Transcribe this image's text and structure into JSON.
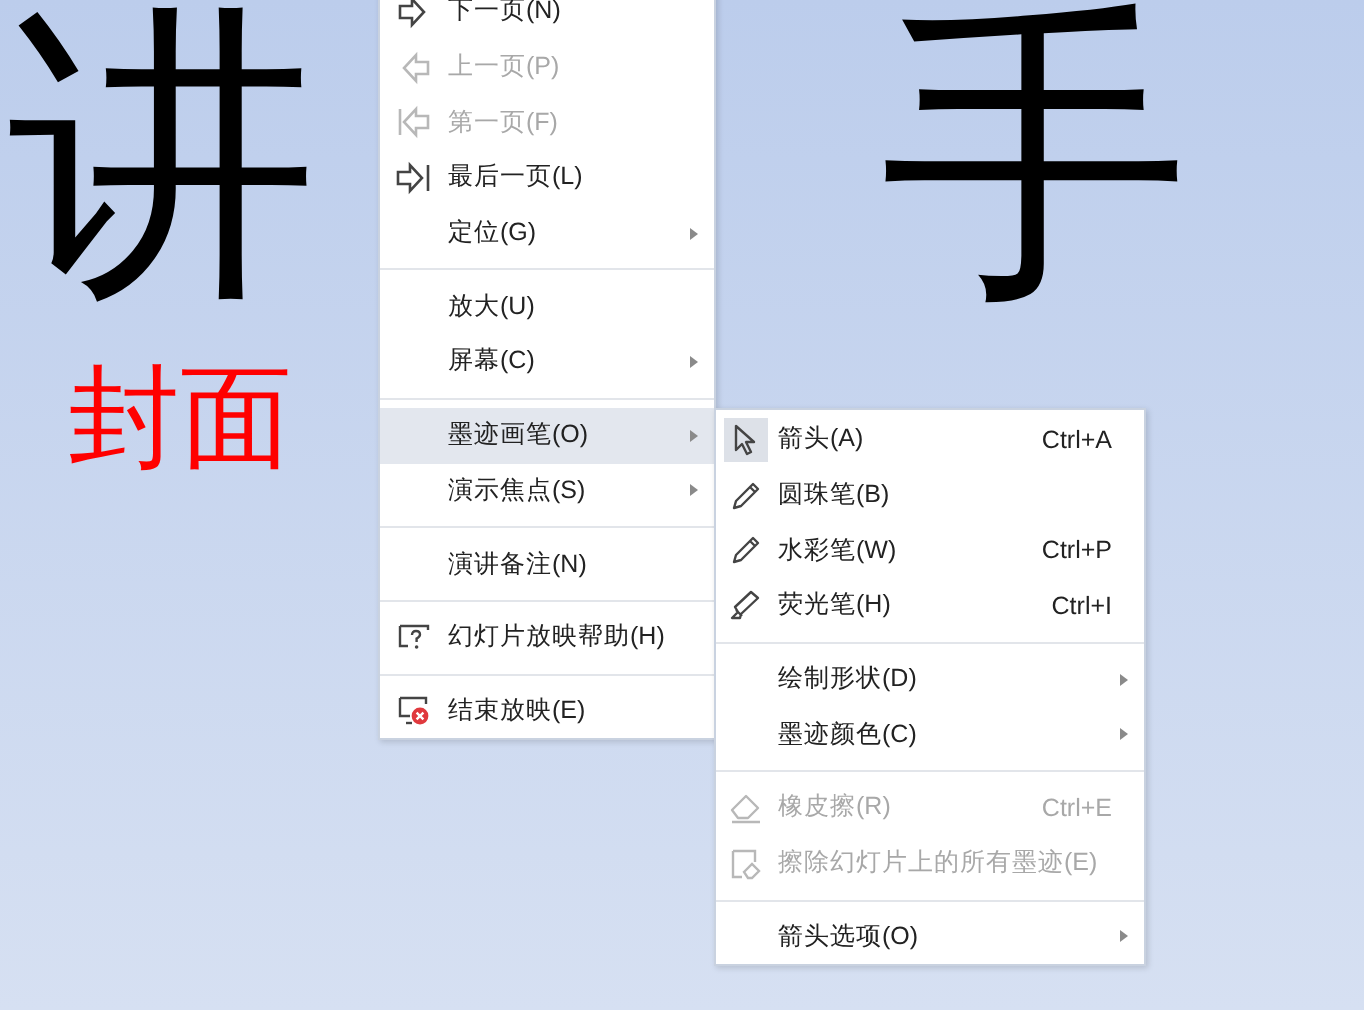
{
  "slide": {
    "title_parts": [
      "讲",
      "手"
    ],
    "subtitle": "封面"
  },
  "context_menu": {
    "items": [
      {
        "kind": "next",
        "label": "下一页(N)",
        "disabled": false,
        "highlighted": false,
        "submenu": false
      },
      {
        "kind": "prev",
        "label": "上一页(P)",
        "disabled": true,
        "highlighted": false,
        "submenu": false
      },
      {
        "kind": "first",
        "label": "第一页(F)",
        "disabled": true,
        "highlighted": false,
        "submenu": false
      },
      {
        "kind": "last",
        "label": "最后一页(L)",
        "disabled": false,
        "highlighted": false,
        "submenu": false
      },
      {
        "kind": "plain",
        "label": "定位(G)",
        "disabled": false,
        "highlighted": false,
        "submenu": true
      },
      {
        "kind": "separator"
      },
      {
        "kind": "plain",
        "label": "放大(U)",
        "disabled": false,
        "highlighted": false,
        "submenu": false
      },
      {
        "kind": "plain",
        "label": "屏幕(C)",
        "disabled": false,
        "highlighted": false,
        "submenu": true
      },
      {
        "kind": "separator"
      },
      {
        "kind": "plain",
        "label": "墨迹画笔(O)",
        "disabled": false,
        "highlighted": true,
        "submenu": true
      },
      {
        "kind": "plain",
        "label": "演示焦点(S)",
        "disabled": false,
        "highlighted": false,
        "submenu": true
      },
      {
        "kind": "separator"
      },
      {
        "kind": "plain",
        "label": "演讲备注(N)",
        "disabled": false,
        "highlighted": false,
        "submenu": false
      },
      {
        "kind": "separator"
      },
      {
        "kind": "help",
        "label": "幻灯片放映帮助(H)",
        "disabled": false,
        "highlighted": false,
        "submenu": false
      },
      {
        "kind": "separator"
      },
      {
        "kind": "end",
        "label": "结束放映(E)",
        "disabled": false,
        "highlighted": false,
        "submenu": false
      }
    ]
  },
  "pen_submenu": {
    "items": [
      {
        "kind": "pointer",
        "label": "箭头(A)",
        "shortcut": "Ctrl+A",
        "checked": true,
        "disabled": false,
        "submenu": false
      },
      {
        "kind": "pen",
        "label": "圆珠笔(B)",
        "checked": false,
        "disabled": false,
        "submenu": false
      },
      {
        "kind": "pen",
        "label": "水彩笔(W)",
        "shortcut": "Ctrl+P",
        "checked": false,
        "disabled": false,
        "submenu": false
      },
      {
        "kind": "highlighter",
        "label": "荧光笔(H)",
        "shortcut": "Ctrl+I",
        "checked": false,
        "disabled": false,
        "submenu": false
      },
      {
        "kind": "separator"
      },
      {
        "kind": "plain",
        "label": "绘制形状(D)",
        "checked": false,
        "disabled": false,
        "submenu": true
      },
      {
        "kind": "plain",
        "label": "墨迹颜色(C)",
        "checked": false,
        "disabled": false,
        "submenu": true
      },
      {
        "kind": "separator"
      },
      {
        "kind": "eraser",
        "label": "橡皮擦(R)",
        "shortcut": "Ctrl+E",
        "checked": false,
        "disabled": true,
        "submenu": false
      },
      {
        "kind": "clear",
        "label": "擦除幻灯片上的所有墨迹(E)",
        "checked": false,
        "disabled": true,
        "submenu": false
      },
      {
        "kind": "separator"
      },
      {
        "kind": "plain",
        "label": "箭头选项(O)",
        "checked": false,
        "disabled": false,
        "submenu": true
      }
    ]
  }
}
